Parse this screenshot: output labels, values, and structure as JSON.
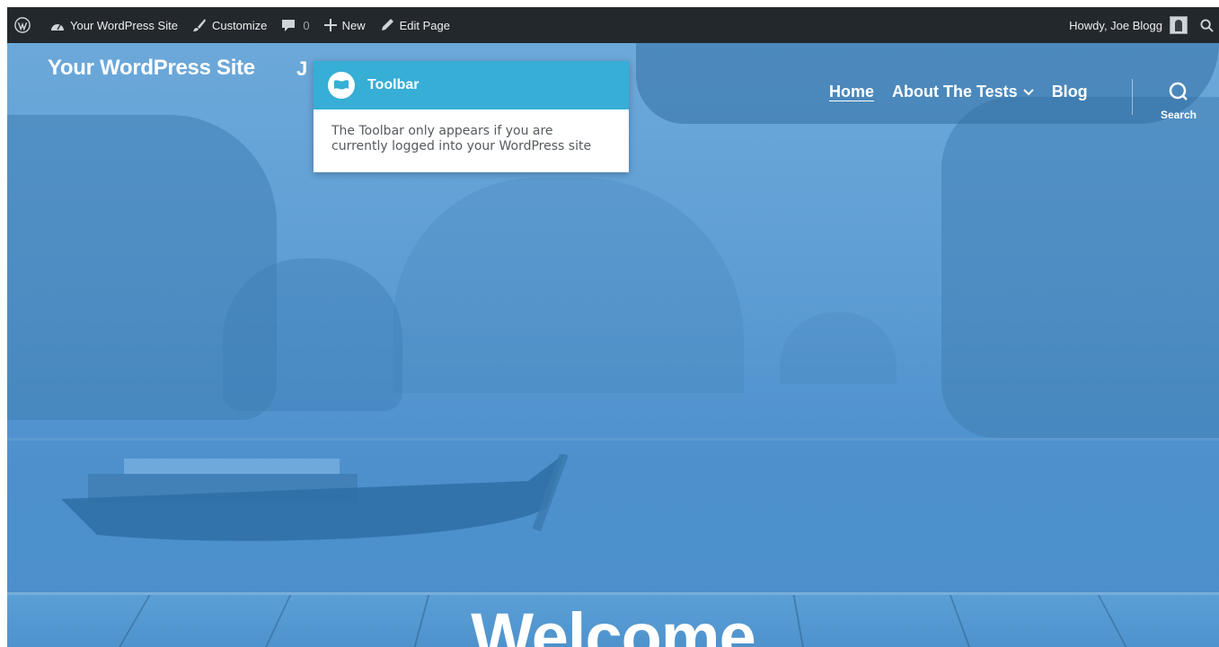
{
  "adminbar": {
    "site_name": "Your WordPress Site",
    "customize": "Customize",
    "comments_count": "0",
    "new": "New",
    "edit_page": "Edit Page",
    "howdy": "Howdy, Joe Blogg"
  },
  "site": {
    "title": "Your WordPress Site",
    "title_trail": "J"
  },
  "nav": {
    "items": [
      {
        "label": "Home"
      },
      {
        "label": "About The Tests"
      },
      {
        "label": "Blog"
      }
    ],
    "search_label": "Search"
  },
  "pointer": {
    "title": "Toolbar",
    "body": "The Toolbar only appears if you are currently logged into your WordPress site"
  },
  "hero": {
    "heading": "Welcome"
  },
  "colors": {
    "adminbar_bg": "#23282d",
    "pointer_head": "#36aed6",
    "hero_overlay": "#5a9fd6"
  }
}
